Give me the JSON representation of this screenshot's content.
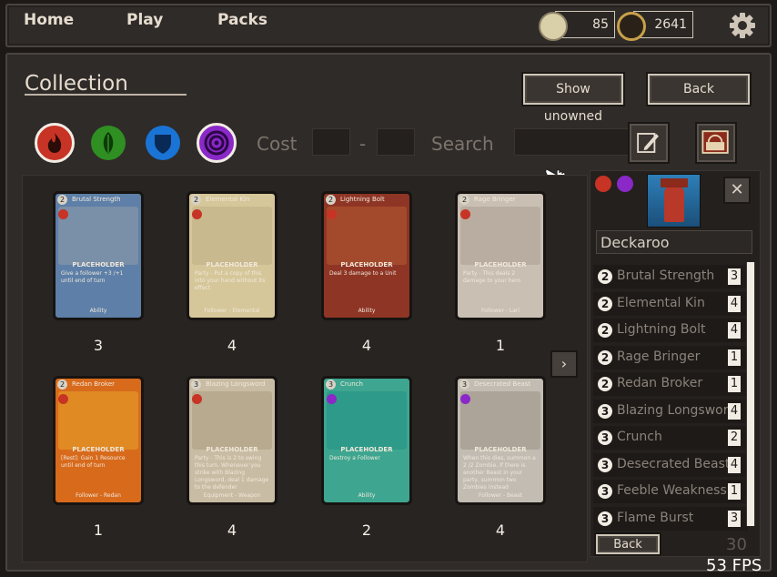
{
  "nav": {
    "home": "Home",
    "play": "Play",
    "packs": "Packs"
  },
  "currency": {
    "coins": "85",
    "gems": "2641"
  },
  "icons": {
    "settings": "gear-icon",
    "coins": "scroll-icon",
    "gems": "orb-icon"
  },
  "collection": {
    "title": "Collection",
    "show_unowned": "Show unowned",
    "back": "Back",
    "cost_label": "Cost",
    "dash": "-",
    "search_label": "Search"
  },
  "factions": [
    {
      "name": "fire",
      "color": "#c73325"
    },
    {
      "name": "nature",
      "color": "#2f8f22"
    },
    {
      "name": "water",
      "color": "#1a74d6"
    },
    {
      "name": "shadow",
      "color": "#8a28c8"
    }
  ],
  "cards": [
    {
      "name": "Brutal Strength",
      "cost": "2",
      "placeholder": "PLACEHOLDER",
      "text": "Give a follower +3 /+1 until end of turn",
      "type": "Ability",
      "count": "3",
      "bg": "#5d7fa8",
      "art": "#7a8fa8",
      "faction": "#c73325"
    },
    {
      "name": "Elemental Kin",
      "cost": "2",
      "placeholder": "PLACEHOLDER",
      "text": "Party - Put a copy of this into your hand without its effect",
      "type": "Follower - Elemental",
      "count": "4",
      "bg": "#d6c79a",
      "art": "#c9b98e",
      "faction": "#c73325"
    },
    {
      "name": "Lightning Bolt",
      "cost": "2",
      "placeholder": "PLACEHOLDER",
      "text": "Deal 3 damage to a Unit",
      "type": "Ability",
      "count": "4",
      "bg": "#8f3525",
      "art": "#a44a2c",
      "faction": "#c73325"
    },
    {
      "name": "Rage Bringer",
      "cost": "2",
      "placeholder": "PLACEHOLDER",
      "text": "Party - This deals 2 damage to your hero",
      "type": "Follower - Lari",
      "count": "1",
      "bg": "#c9c0b3",
      "art": "#b8ada0",
      "faction": "#c73325"
    },
    {
      "name": "Redan Broker",
      "cost": "2",
      "placeholder": "PLACEHOLDER",
      "text": "[Rest]: Gain 1 Resource until end of turn",
      "type": "Follower - Redan",
      "count": "1",
      "bg": "#d86a1c",
      "art": "#e08a24",
      "faction": "#c73325"
    },
    {
      "name": "Blazing Longsword",
      "cost": "3",
      "placeholder": "PLACEHOLDER",
      "text": "Party - This is 2 to swing this turn. Whenever you strike with Blazing Longsword, deal 1 damage to the defender",
      "type": "Equipment - Weapon",
      "count": "4",
      "bg": "#c9bca4",
      "art": "#b8aa8e",
      "faction": "#c73325"
    },
    {
      "name": "Crunch",
      "cost": "3",
      "placeholder": "PLACEHOLDER",
      "text": "Destroy a Follower",
      "type": "Ability",
      "count": "2",
      "bg": "#3ea690",
      "art": "#2e9a8a",
      "faction": "#8a28c8"
    },
    {
      "name": "Desecrated Beast",
      "cost": "3",
      "placeholder": "PLACEHOLDER",
      "text": "When this dies, summon a 2 /2 Zombie. If there is another Beast in your party, summon two Zombies instead",
      "type": "Follower - Beast",
      "count": "4",
      "bg": "#c2bcb2",
      "art": "#aca498",
      "faction": "#8a28c8"
    }
  ],
  "deck": {
    "name": "Deckaroo",
    "total": "30",
    "back": "Back",
    "factions": [
      "#c73325",
      "#8a28c8"
    ],
    "rows": [
      {
        "cost": "2",
        "name": "Brutal Strength",
        "qty": "3"
      },
      {
        "cost": "2",
        "name": "Elemental Kin",
        "qty": "4"
      },
      {
        "cost": "2",
        "name": "Lightning Bolt",
        "qty": "4"
      },
      {
        "cost": "2",
        "name": "Rage Bringer",
        "qty": "1"
      },
      {
        "cost": "2",
        "name": "Redan Broker",
        "qty": "1"
      },
      {
        "cost": "3",
        "name": "Blazing Longsword",
        "qty": "4"
      },
      {
        "cost": "3",
        "name": "Crunch",
        "qty": "2"
      },
      {
        "cost": "3",
        "name": "Desecrated Beast",
        "qty": "4"
      },
      {
        "cost": "3",
        "name": "Feeble Weakness",
        "qty": "1"
      },
      {
        "cost": "3",
        "name": "Flame Burst",
        "qty": "3"
      }
    ]
  },
  "fps": "53 FPS"
}
